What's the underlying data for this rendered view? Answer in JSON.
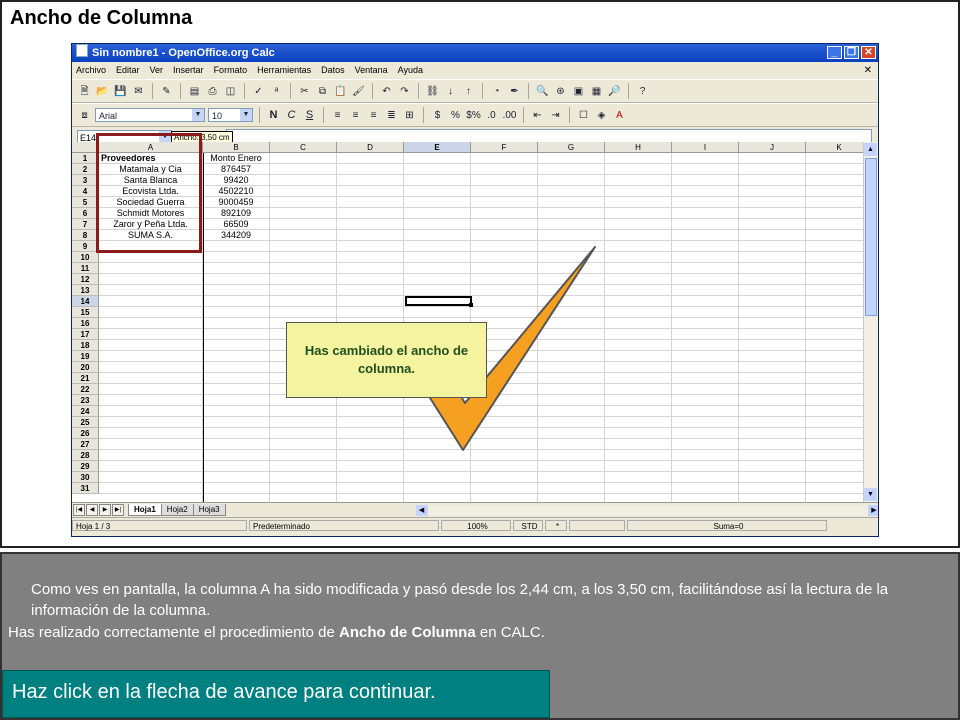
{
  "slide": {
    "title": "Ancho de Columna",
    "description": "Como ves en pantalla, la columna A ha sido modificada y pasó desde los 2,44 cm, a los 3,50 cm, facilitándose así la lectura de la información de la columna.",
    "done_prefix": "Has realizado correctamente el procedimiento de ",
    "done_bold": "Ancho de Columna",
    "done_suffix": " en CALC.",
    "continue": "Haz click en la flecha de avance para continuar.",
    "message": "Has cambiado el ancho de columna."
  },
  "window": {
    "title": "Sin nombre1 - OpenOffice.org Calc",
    "menu": [
      "Archivo",
      "Editar",
      "Ver",
      "Insertar",
      "Formato",
      "Herramientas",
      "Datos",
      "Ventana",
      "Ayuda"
    ],
    "font_name": "Arial",
    "font_size": "10",
    "name_box": "E14",
    "tooltip": "Ancho: 3,50 cm"
  },
  "sheet": {
    "columns": [
      "A",
      "B",
      "C",
      "D",
      "E",
      "F",
      "G",
      "H",
      "I",
      "J",
      "K"
    ],
    "selected_column": "E",
    "selected_row": "14",
    "rows": [
      "1",
      "2",
      "3",
      "4",
      "5",
      "6",
      "7",
      "8",
      "9",
      "10",
      "11",
      "12",
      "13",
      "14",
      "15",
      "16",
      "17",
      "18",
      "19",
      "20",
      "21",
      "22",
      "23",
      "24",
      "25",
      "26",
      "27",
      "28",
      "29",
      "30",
      "31"
    ],
    "cells": [
      {
        "a": "Proveedores",
        "b": "Monto Enero"
      },
      {
        "a": "Matamala y Cia",
        "b": "876457"
      },
      {
        "a": "Santa Blanca",
        "b": "99420"
      },
      {
        "a": "Ecovista Ltda.",
        "b": "4502210"
      },
      {
        "a": "Sociedad Guerra",
        "b": "9000459"
      },
      {
        "a": "Schmidt Motores",
        "b": "892109"
      },
      {
        "a": "Zaror y Peña Ltda.",
        "b": "66509"
      },
      {
        "a": "SUMA S.A.",
        "b": "344209"
      }
    ],
    "tabs": [
      "Hoja1",
      "Hoja2",
      "Hoja3"
    ]
  },
  "status": {
    "sheet": "Hoja 1 / 3",
    "style": "Predeterminado",
    "zoom": "100%",
    "mode": "STD",
    "modified": "*",
    "sum": "Suma=0"
  },
  "colors": {
    "accent_orange": "#f5a020",
    "message_bg": "#f4f3a0",
    "highlight_red": "#8b1a1a",
    "continue_bg": "#008080"
  }
}
